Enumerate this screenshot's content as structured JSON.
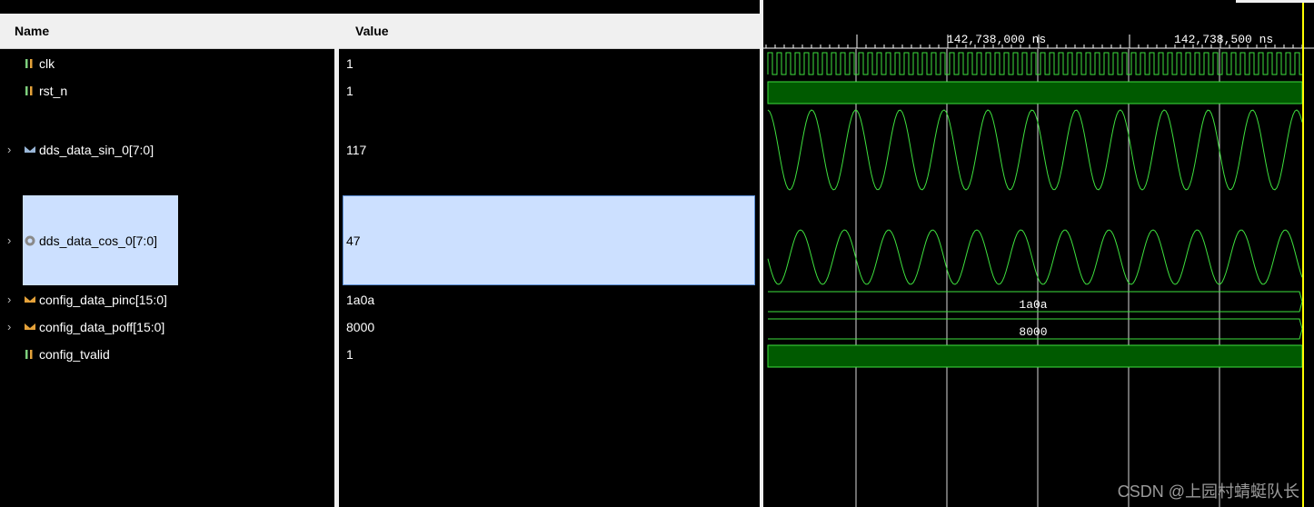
{
  "columns": {
    "name": "Name",
    "value": "Value"
  },
  "signals": [
    {
      "name": "clk",
      "value": "1",
      "kind": "bit",
      "expandable": false
    },
    {
      "name": "rst_n",
      "value": "1",
      "kind": "bit",
      "expandable": false
    },
    {
      "name": "dds_data_sin_0[7:0]",
      "value": "117",
      "kind": "bus",
      "expandable": true
    },
    {
      "name": "dds_data_cos_0[7:0]",
      "value": "47",
      "kind": "bus",
      "expandable": true,
      "selected": true
    },
    {
      "name": "config_data_pinc[15:0]",
      "value": "1a0a",
      "kind": "bus",
      "expandable": true
    },
    {
      "name": "config_data_poff[15:0]",
      "value": "8000",
      "kind": "bus",
      "expandable": true
    },
    {
      "name": "config_tvalid",
      "value": "1",
      "kind": "bit",
      "expandable": false
    }
  ],
  "waveform": {
    "time_labels": [
      "142,738,000 ns",
      "142,738,500 ns"
    ],
    "pinc_bus_label": "1a0a",
    "poff_bus_label": "8000",
    "colors": {
      "wave": "#3ee03e",
      "fill": "#005a00",
      "cursor": "#ffff00",
      "grid": "#d8d8d8"
    }
  },
  "watermark": "CSDN @上园村蜻蜓队长"
}
